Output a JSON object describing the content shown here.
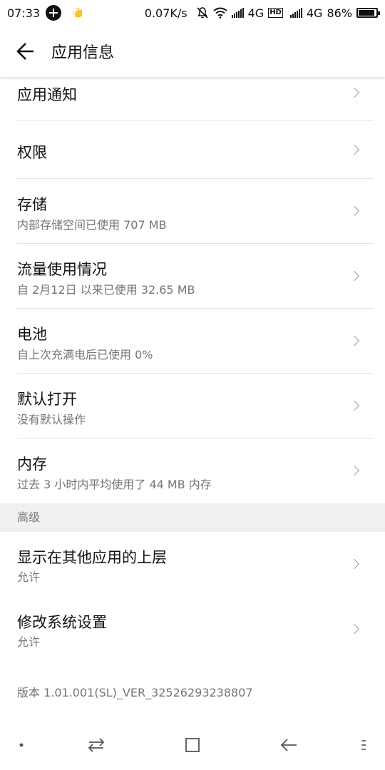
{
  "status_bar": {
    "time": "07:33",
    "net_speed": "0.07K/s",
    "network_1": "4G",
    "hd": "HD",
    "network_2": "4G",
    "battery": "86%"
  },
  "app_bar": {
    "title": "应用信息"
  },
  "rows": [
    {
      "title": "应用通知",
      "subtitle": ""
    },
    {
      "title": "权限",
      "subtitle": ""
    },
    {
      "title": "存储",
      "subtitle": "内部存储空间已使用 707 MB"
    },
    {
      "title": "流量使用情况",
      "subtitle": "自 2月12日 以来已使用 32.65 MB"
    },
    {
      "title": "电池",
      "subtitle": "自上次充满电后已使用 0%"
    },
    {
      "title": "默认打开",
      "subtitle": "没有默认操作"
    },
    {
      "title": "内存",
      "subtitle": "过去 3 小时内平均使用了 44 MB 内存"
    }
  ],
  "advanced": {
    "header": "高级",
    "rows": [
      {
        "title": "显示在其他应用的上层",
        "subtitle": "允许"
      },
      {
        "title": "修改系统设置",
        "subtitle": "允许"
      }
    ]
  },
  "version": "版本 1.01.001(SL)_VER_32526293238807",
  "colors": {
    "primary_text": "#111111",
    "secondary_text": "#757575",
    "divider": "#e4e4e4",
    "section_bg": "#f0f0f0"
  },
  "icons": {
    "back": "arrow-left-icon",
    "chevron": "chevron-right-icon",
    "nav": [
      "dot-icon",
      "switch-icon",
      "square-icon",
      "back-arrow-icon",
      "menu-icon"
    ]
  }
}
